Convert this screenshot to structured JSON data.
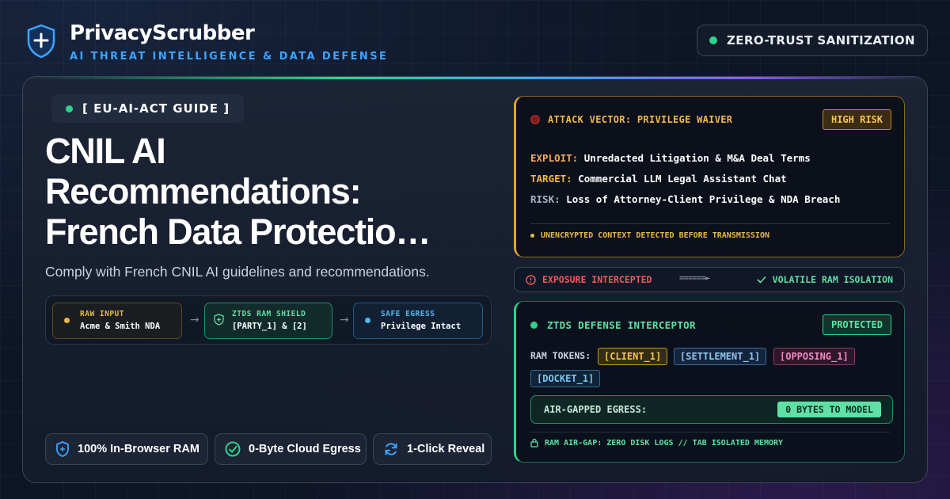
{
  "brand": {
    "name": "PrivacyScrubber",
    "tagline": "AI THREAT INTELLIGENCE & DATA DEFENSE",
    "badge": "ZERO-TRUST SANITIZATION"
  },
  "hero": {
    "guide_label": "[ EU-AI-ACT GUIDE ]",
    "title_lines": [
      "CNIL AI",
      "Recommendations:",
      "French Data Protectio…"
    ],
    "subtitle": "Comply with French CNIL AI guidelines and recommendations."
  },
  "flow": {
    "steps": [
      {
        "label": "RAW INPUT",
        "value": "Acme & Smith NDA"
      },
      {
        "label": "ZTDS RAM SHIELD",
        "value": "[PARTY_1] & [2]"
      },
      {
        "label": "SAFE EGRESS",
        "value": "Privilege Intact"
      }
    ],
    "arrow": "→"
  },
  "features": [
    {
      "label": "100% In-Browser RAM",
      "icon": "shield-plus-icon"
    },
    {
      "label": "0-Byte Cloud Egress",
      "icon": "check-circle-icon"
    },
    {
      "label": "1-Click Reveal",
      "icon": "refresh-icon"
    }
  ],
  "attack": {
    "title": "ATTACK VECTOR: PRIVILEGE WAIVER",
    "badge": "HIGH RISK",
    "lines": [
      {
        "key": "EXPLOIT:",
        "value": "Unredacted Litigation & M&A Deal Terms"
      },
      {
        "key": "TARGET:",
        "value": "Commercial LLM Legal Assistant Chat"
      },
      {
        "key": "RISK:",
        "value": "Loss of Attorney-Client Privilege & NDA Breach"
      }
    ],
    "footer": "UNENCRYPTED CONTEXT DETECTED BEFORE TRANSMISSION"
  },
  "status": {
    "left": "EXPOSURE INTERCEPTED",
    "arrow": "======►",
    "right": "VOLATILE RAM ISOLATION"
  },
  "defense": {
    "title": "ZTDS DEFENSE INTERCEPTOR",
    "badge": "PROTECTED",
    "tokens_label": "RAM TOKENS:",
    "tokens": [
      "[CLIENT_1]",
      "[SETTLEMENT_1]",
      "[OPPOSING_1]",
      "[DOCKET_1]"
    ],
    "egress_label": "AIR-GAPPED EGRESS:",
    "egress_value": "0 BYTES TO MODEL",
    "footer": "RAM AIR-GAP: ZERO DISK LOGS // TAB ISOLATED MEMORY"
  },
  "colors": {
    "accent_green": "#2bd48a",
    "accent_blue": "#3ea3ff",
    "warning_amber": "#e6a12a",
    "danger_red": "#f05a5a",
    "background": "#0e1526"
  }
}
